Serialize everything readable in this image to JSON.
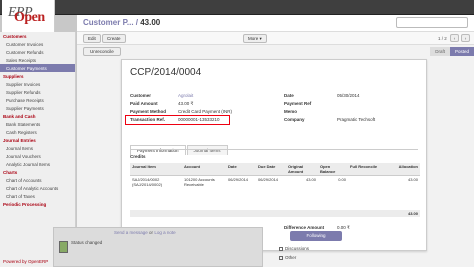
{
  "app": {
    "logo_open": "Open",
    "logo_erp": "ERP"
  },
  "sidebar": {
    "sections": [
      {
        "title": "Customers",
        "items": [
          "Customer Invoices",
          "Customer Refunds",
          "Sales Receipts",
          "Customer Payments"
        ]
      },
      {
        "title": "Suppliers",
        "items": [
          "Supplier Invoices",
          "Supplier Refunds",
          "Purchase Receipts",
          "Supplier Payments"
        ]
      },
      {
        "title": "Bank and Cash",
        "items": [
          "Bank Statements",
          "Cash Registers"
        ]
      },
      {
        "title": "Journal Entries",
        "items": [
          "Journal Items",
          "Journal Vouchers",
          "Analytic Journal Items"
        ]
      },
      {
        "title": "Charts",
        "items": [
          "Chart of Accounts",
          "Chart of Analytic Accounts",
          "Chart of Taxes"
        ]
      },
      {
        "title": "Periodic Processing",
        "items": []
      }
    ],
    "active_item": "Customer Payments",
    "powered_by": "Powered by OpenERP"
  },
  "breadcrumb": {
    "parent": "Customer P...",
    "current": "43.00"
  },
  "toolbar": {
    "edit": "Edit",
    "create": "Create",
    "more": "More ▾",
    "pager": "1 / 2"
  },
  "statusbar": {
    "unreconcile": "Unreconcile",
    "states": [
      "Draft",
      "Posted"
    ],
    "active_state": "Posted"
  },
  "form": {
    "title": "CCP/2014/0004",
    "left_fields": [
      {
        "label": "Customer",
        "value": "Agrolait",
        "link": true
      },
      {
        "label": "Paid Amount",
        "value": "43.00 ₹"
      },
      {
        "label": "Payment Method",
        "value": "Credit Card Payment (INR)"
      },
      {
        "label": "Transaction Ref.",
        "value": "00000001-13533210"
      }
    ],
    "right_fields": [
      {
        "label": "Date",
        "value": "05/30/2014"
      },
      {
        "label": "Payment Ref",
        "value": ""
      },
      {
        "label": "Memo",
        "value": ""
      },
      {
        "label": "Company",
        "value": "Pragmatic Techsoft"
      }
    ],
    "tabs": [
      "Payment Information",
      "Journal Items"
    ],
    "active_tab": "Payment Information",
    "credits_label": "Credits",
    "table": {
      "headers": [
        "Journal Item",
        "Account",
        "Date",
        "Due Date",
        "Original Amount",
        "Open Balance",
        "Full Reconcile",
        "Allocation"
      ],
      "rows": [
        [
          "SAJ/2014/0002 (SAJ/2014/0002)",
          "101200 Accounts Receivable",
          "06/29/2014",
          "06/29/2014",
          "43.00",
          "0.00",
          "",
          "43.00"
        ]
      ],
      "total": "43.00"
    },
    "difference_label": "Difference Amount",
    "difference_value": "0.00 ₹"
  },
  "chatter": {
    "send_message": "Send a message",
    "or": "or",
    "log_note": "Log a note",
    "message": "Status changed",
    "follow_label": "Following",
    "followers": [
      "Discussions",
      "Other"
    ]
  }
}
